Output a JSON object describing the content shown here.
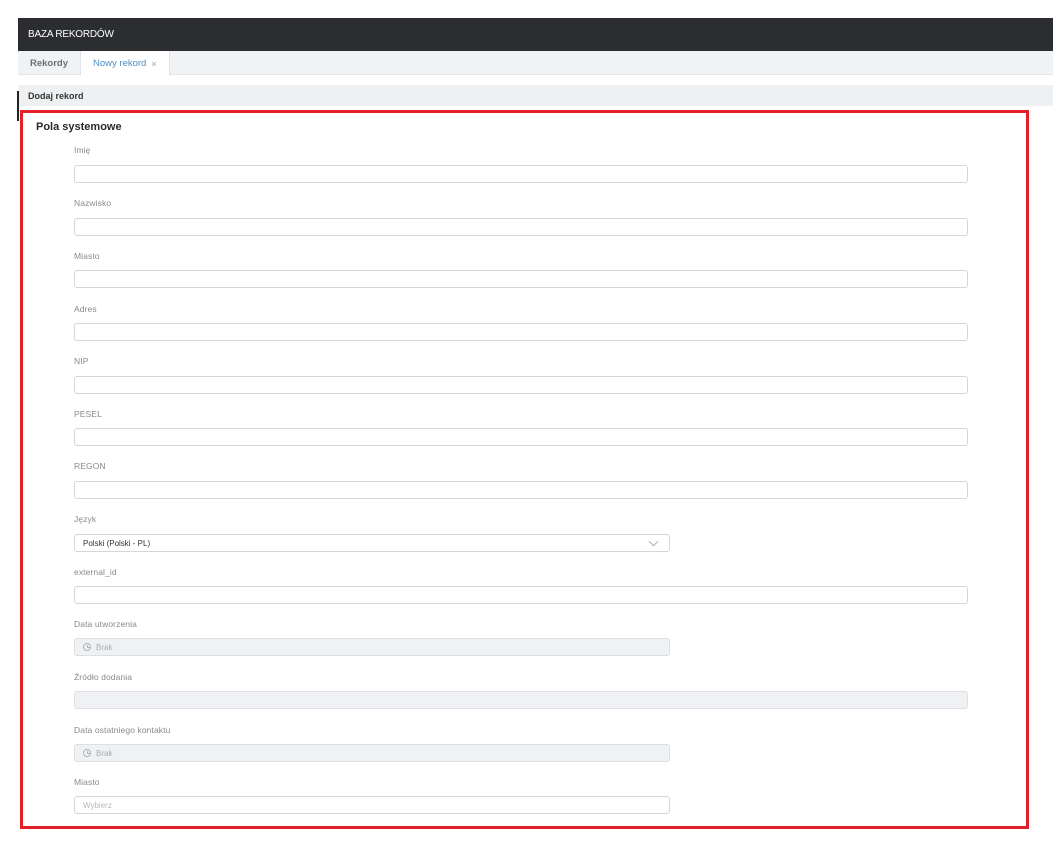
{
  "app": {
    "title": "BAZA REKORDÓW"
  },
  "tabs": [
    {
      "label": "Rekordy"
    },
    {
      "label": "Nowy rekord",
      "close": "×"
    }
  ],
  "subheader": {
    "title": "Dodaj rekord"
  },
  "section": {
    "title": "Pola systemowe"
  },
  "fields": {
    "imie": {
      "label": "Imię",
      "value": ""
    },
    "nazwisko": {
      "label": "Nazwisko",
      "value": ""
    },
    "miasto": {
      "label": "Miasto",
      "value": ""
    },
    "adres": {
      "label": "Adres",
      "value": ""
    },
    "nip": {
      "label": "NIP",
      "value": ""
    },
    "pesel": {
      "label": "PESEL",
      "value": ""
    },
    "regon": {
      "label": "REGON",
      "value": ""
    },
    "jezyk": {
      "label": "Język",
      "value": "Polski (Polski - PL)"
    },
    "external_id": {
      "label": "external_id",
      "value": ""
    },
    "data_utworzenia": {
      "label": "Data utworzenia",
      "value": "Brak",
      "icon": "clock-icon"
    },
    "zrodlo_dodania": {
      "label": "Źródło dodania",
      "value": ""
    },
    "data_ostatniego_kontaktu": {
      "label": "Data ostatniego kontaktu",
      "value": "Brak",
      "icon": "clock-icon"
    },
    "miasto_select": {
      "label": "Miasto",
      "placeholder": "Wybierz"
    }
  },
  "colors": {
    "highlight": "#e3202a",
    "topbar": "#2b2d31",
    "active_tab": "#4d8fc8"
  }
}
